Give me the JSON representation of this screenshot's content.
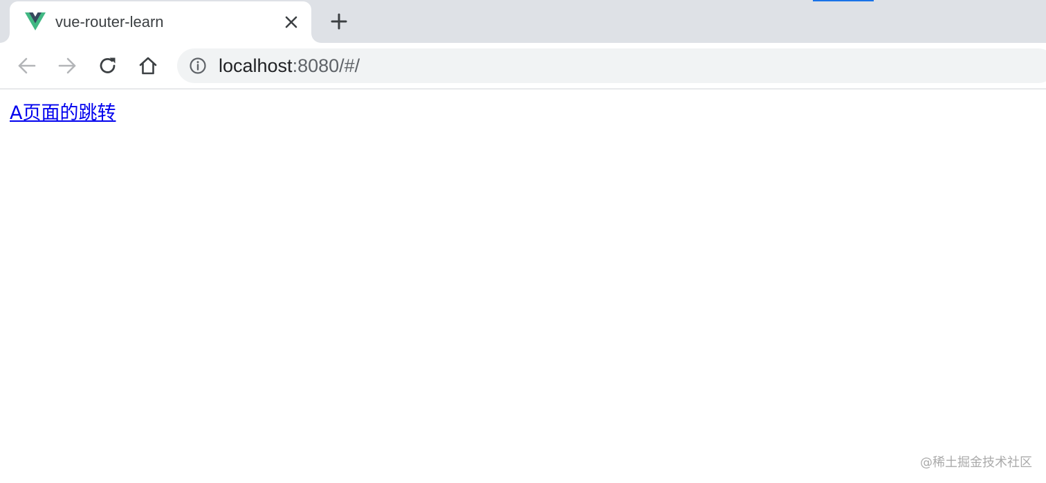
{
  "tab": {
    "title": "vue-router-learn",
    "favicon": "vue-logo-icon",
    "close_icon": "close-icon"
  },
  "new_tab_icon": "plus-icon",
  "toolbar": {
    "back_icon": "arrow-left-icon",
    "forward_icon": "arrow-right-icon",
    "reload_icon": "reload-icon",
    "home_icon": "home-icon"
  },
  "address_bar": {
    "info_icon": "info-icon",
    "host": "localhost",
    "rest": ":8080/#/"
  },
  "page": {
    "link_text": "A页面的跳转"
  },
  "watermark": "@稀土掘金技术社区",
  "colors": {
    "tab_strip": "#dee1e6",
    "accent": "#1a73e8",
    "omnibox_bg": "#f1f3f4",
    "link": "#0000ee",
    "vue_green": "#41b883",
    "vue_dark": "#35495e"
  }
}
